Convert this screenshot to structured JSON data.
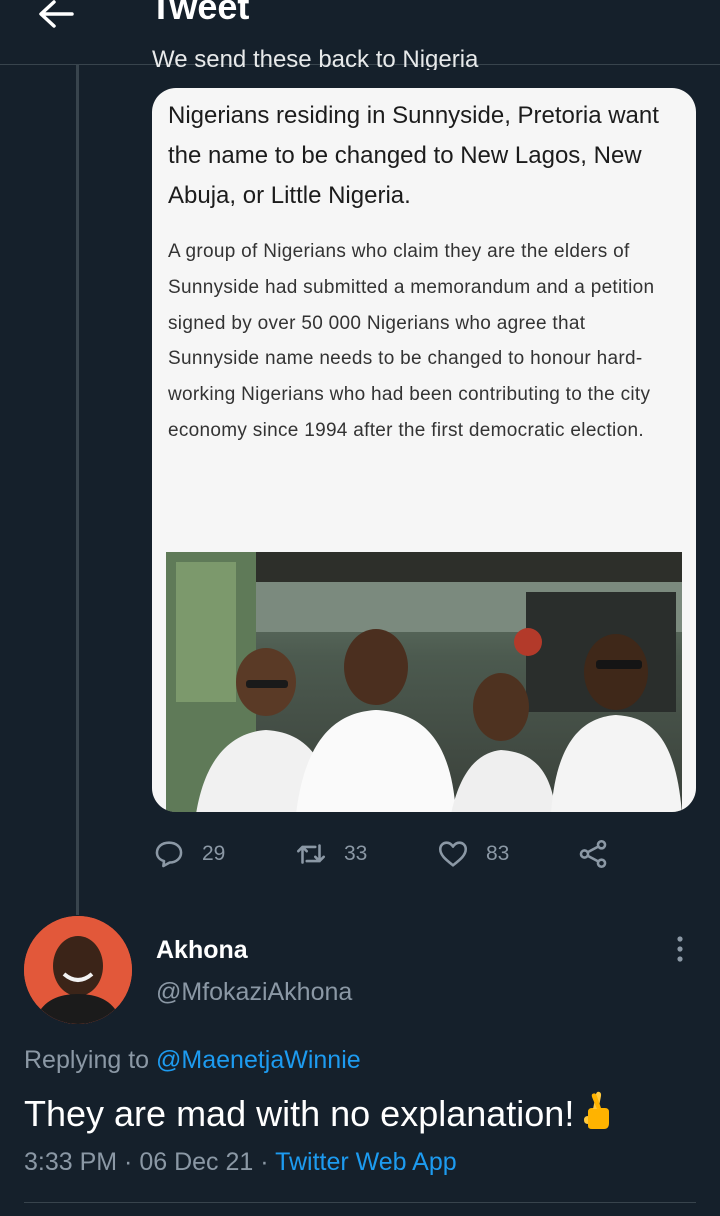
{
  "header": {
    "title": "Tweet"
  },
  "parent_tweet": {
    "cut_text": "We send these back to Nigeria",
    "card": {
      "headline": "Nigerians residing in Sunnyside, Pretoria want the name to be changed to New Lagos, New Abuja, or Little Nigeria.",
      "body": "A group of Nigerians who claim they are the elders of Sunnyside had submitted a memorandum and a petition signed by over 50 000 Nigerians who agree that Sunnyside name needs to be changed to honour hard-working Nigerians who had been contributing to the city economy since 1994 after the first democratic election."
    },
    "actions": {
      "replies": "29",
      "retweets": "33",
      "likes": "83"
    }
  },
  "reply_tweet": {
    "name": "Akhona",
    "handle": "@MfokaziAkhona",
    "replying_prefix": "Replying to",
    "replying_to": "@MaenetjaWinnie",
    "text": "They are mad with no explanation!",
    "emoji": "crossed-fingers-emoji",
    "time": "3:33 PM",
    "date": "06 Dec 21",
    "source": "Twitter Web App"
  },
  "colors": {
    "background": "#15202b",
    "secondary_text": "#8b98a5",
    "link": "#1d9bf0",
    "border": "#38444d"
  }
}
